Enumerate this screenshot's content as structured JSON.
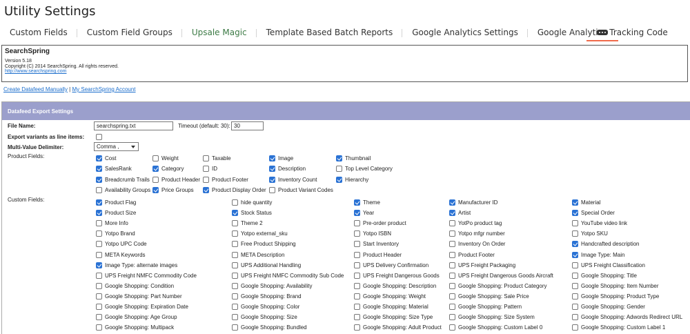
{
  "page_title": "Utility Settings",
  "tabs": [
    {
      "label": "Custom Fields",
      "accent": false
    },
    {
      "label": "Custom Field Groups",
      "accent": false
    },
    {
      "label": "Upsale Magic",
      "accent": true
    },
    {
      "label": "Template Based Batch Reports",
      "accent": false
    },
    {
      "label": "Google Analytics Settings",
      "accent": false
    },
    {
      "label": "Google Analytics Tracking Code",
      "accent": false
    }
  ],
  "more_tab_icon": "more-dots-icon",
  "info": {
    "brand": "SearchSpring",
    "version": "Version 5.18",
    "copyright": "Copyright (C) 2014 SearchSpring. All rights reserved.",
    "link": "http://www.searchspring.com"
  },
  "links": {
    "create": "Create Datafeed Manually",
    "sep": " | ",
    "account": "My SearchSpring Account"
  },
  "panel": {
    "title": "Datafeed Export Settings",
    "file_name_label": "File Name:",
    "file_name_value": "searchspring.txt",
    "timeout_label": "Timeout (default: 30):",
    "timeout_value": "30",
    "variants_label": "Export variants as line items:",
    "delimiter_label": "Multi-Value Delimiter:",
    "delimiter_value": "Comma ,",
    "product_fields_label": "Product Fields:",
    "custom_fields_label": "Custom Fields:"
  },
  "product_fields": [
    [
      {
        "l": "Cost",
        "c": true
      },
      {
        "l": "Weight",
        "c": false
      },
      {
        "l": "Taxable",
        "c": false
      },
      {
        "l": "Image",
        "c": true
      },
      {
        "l": "Thumbnail",
        "c": true
      }
    ],
    [
      {
        "l": "SalesRank",
        "c": true
      },
      {
        "l": "Category",
        "c": true
      },
      {
        "l": "ID",
        "c": false
      },
      {
        "l": "Description",
        "c": true
      },
      {
        "l": "Top Level Category",
        "c": false
      }
    ],
    [
      {
        "l": "Breadcrumb Trails",
        "c": true
      },
      {
        "l": "Product Header",
        "c": false
      },
      {
        "l": "Product Footer",
        "c": false
      },
      {
        "l": "Inventory Count",
        "c": true
      },
      {
        "l": "Hierarchy",
        "c": true
      }
    ],
    [
      {
        "l": "Availability Groups",
        "c": false
      },
      {
        "l": "Price Groups",
        "c": true
      },
      {
        "l": "Product Display Order",
        "c": true
      },
      {
        "l": "Product Variant Codes",
        "c": false
      }
    ]
  ],
  "custom_fields": [
    [
      {
        "l": "Product Flag",
        "c": true
      },
      {
        "l": "hide quantity",
        "c": false
      },
      {
        "l": "Theme",
        "c": true
      },
      {
        "l": "Manufacturer ID",
        "c": true
      },
      {
        "l": "Material",
        "c": true
      }
    ],
    [
      {
        "l": "Product Size",
        "c": true
      },
      {
        "l": "Stock Status",
        "c": true
      },
      {
        "l": "Year",
        "c": true
      },
      {
        "l": "Artist",
        "c": true
      },
      {
        "l": "Special Order",
        "c": true
      }
    ],
    [
      {
        "l": "More Info",
        "c": false
      },
      {
        "l": "Theme 2",
        "c": false
      },
      {
        "l": "Pre-order product",
        "c": false
      },
      {
        "l": "YotPo product tag",
        "c": false
      },
      {
        "l": "YouTube video link",
        "c": false
      }
    ],
    [
      {
        "l": "Yotpo Brand",
        "c": false
      },
      {
        "l": "Yotpo external_sku",
        "c": false
      },
      {
        "l": "Yotpo ISBN",
        "c": false
      },
      {
        "l": "Yotpo mfgr number",
        "c": false
      },
      {
        "l": "Yotpo SKU",
        "c": false
      }
    ],
    [
      {
        "l": "Yotpo UPC Code",
        "c": false
      },
      {
        "l": "Free Product Shipping",
        "c": false
      },
      {
        "l": "Start Inventory",
        "c": false
      },
      {
        "l": "Inventory On Order",
        "c": false
      },
      {
        "l": "Handcrafted description",
        "c": true
      }
    ],
    [
      {
        "l": "META Keywords",
        "c": false
      },
      {
        "l": "META Description",
        "c": false
      },
      {
        "l": "Product Header",
        "c": false
      },
      {
        "l": "Product Footer",
        "c": false
      },
      {
        "l": "Image Type: Main",
        "c": true
      }
    ],
    [
      {
        "l": "Image Type: alternate images",
        "c": true
      },
      {
        "l": "UPS Additional Handling",
        "c": false
      },
      {
        "l": "UPS Delivery Confirmation",
        "c": false
      },
      {
        "l": "UPS Freight Packaging",
        "c": false
      },
      {
        "l": "UPS Freight Classification",
        "c": false
      }
    ],
    [
      {
        "l": "UPS Freight NMFC Commodity Code",
        "c": false
      },
      {
        "l": "UPS Freight NMFC Commodity Sub Code",
        "c": false
      },
      {
        "l": "UPS Freight Dangerous Goods",
        "c": false
      },
      {
        "l": "UPS Freight Dangerous Goods Aircraft",
        "c": false
      },
      {
        "l": "Google Shopping: Title",
        "c": false
      }
    ],
    [
      {
        "l": "Google Shopping: Condition",
        "c": false
      },
      {
        "l": "Google Shopping: Availability",
        "c": false
      },
      {
        "l": "Google Shopping: Description",
        "c": false
      },
      {
        "l": "Google Shopping: Product Category",
        "c": false
      },
      {
        "l": "Google Shopping: Item Number",
        "c": false
      }
    ],
    [
      {
        "l": "Google Shopping: Part Number",
        "c": false
      },
      {
        "l": "Google Shopping: Brand",
        "c": false
      },
      {
        "l": "Google Shopping: Weight",
        "c": false
      },
      {
        "l": "Google Shopping: Sale Price",
        "c": false
      },
      {
        "l": "Google Shopping: Product Type",
        "c": false
      }
    ],
    [
      {
        "l": "Google Shopping: Expiration Date",
        "c": false
      },
      {
        "l": "Google Shopping: Color",
        "c": false
      },
      {
        "l": "Google Shopping: Material",
        "c": false
      },
      {
        "l": "Google Shopping: Pattern",
        "c": false
      },
      {
        "l": "Google Shopping: Gender",
        "c": false
      }
    ],
    [
      {
        "l": "Google Shopping: Age Group",
        "c": false
      },
      {
        "l": "Google Shopping: Size",
        "c": false
      },
      {
        "l": "Google Shopping: Size Type",
        "c": false
      },
      {
        "l": "Google Shopping: Size System",
        "c": false
      },
      {
        "l": "Google Shopping: Adwords Redirect URL",
        "c": false
      }
    ],
    [
      {
        "l": "Google Shopping: Multipack",
        "c": false
      },
      {
        "l": "Google Shopping: Bundled",
        "c": false
      },
      {
        "l": "Google Shopping: Adult Product",
        "c": false
      },
      {
        "l": "Google Shopping: Custom Label 0",
        "c": false
      },
      {
        "l": "Google Shopping: Custom Label 1",
        "c": false
      }
    ]
  ]
}
